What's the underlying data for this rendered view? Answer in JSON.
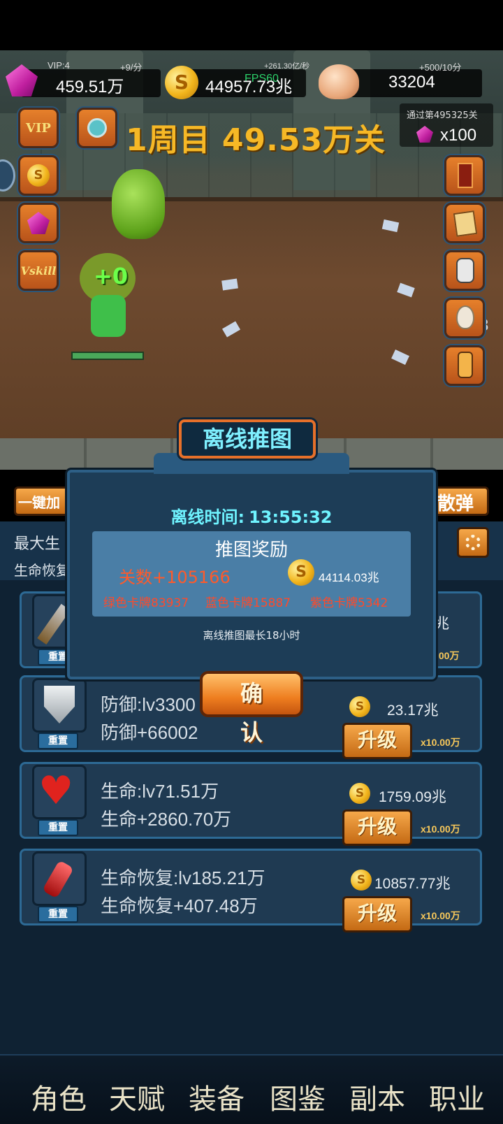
{
  "resources": {
    "gems": {
      "vip": "VIP:4",
      "rate": "+9/分",
      "value": "459.51万"
    },
    "coins": {
      "rate": "+261.30亿/秒",
      "fps": "FPS60",
      "value": "44957.73兆"
    },
    "skulls": {
      "rate": "+500/10分",
      "value": "33204"
    }
  },
  "stage": {
    "title": "1周目 49.53万关"
  },
  "reward_hint": {
    "label": "通过第495325关",
    "gem_count": "x100"
  },
  "left_buttons": {
    "vip": "VIP",
    "skill": "Vskill"
  },
  "floating_text": "+0",
  "side_partial_number": "8",
  "action_bar": {
    "left_label": "一键加",
    "right_label": "散弹"
  },
  "stats_panel": {
    "line1": "最大生",
    "line2": "生命恢复"
  },
  "dialog": {
    "title": "离线推图",
    "offline_time_label": "离线时间:",
    "offline_time_value": "13:55:32",
    "reward_title": "推图奖励",
    "stage_gain": "关数+105166",
    "coin_gain": "44114.03兆",
    "green_cards": "绿色卡牌83937",
    "blue_cards": "蓝色卡牌15887",
    "purple_cards": "紫色卡牌5342",
    "note": "离线推图最长18小时",
    "confirm": "确 认"
  },
  "upgrade_rows": [
    {
      "partial_cost": "兆",
      "partial_mult": ".00万",
      "reset": "重置"
    },
    {
      "name": "防御:lv3300",
      "effect": "防御+66002",
      "cost": "23.17兆",
      "button": "升级",
      "mult": "x10.00万",
      "reset": "重置"
    },
    {
      "name": "生命:lv71.51万",
      "effect": "生命+2860.70万",
      "cost": "1759.09兆",
      "button": "升级",
      "mult": "x10.00万",
      "reset": "重置"
    },
    {
      "name": "生命恢复:lv185.21万",
      "effect": "生命恢复+407.48万",
      "cost": "10857.77兆",
      "button": "升级",
      "mult": "x10.00万",
      "reset": "重置"
    }
  ],
  "bottom_nav": [
    "角色",
    "天赋",
    "装备",
    "图鉴",
    "副本",
    "职业"
  ],
  "colors": {
    "accent_orange": "#e6702a",
    "panel_blue": "#1d3d57",
    "gold": "#f6b826",
    "cyan": "#7ff0ff"
  },
  "icons": [
    "gem-icon",
    "coin-icon",
    "skull-icon",
    "vip-icon",
    "medal-icon",
    "skill-icon",
    "card-icon",
    "robot-icon",
    "egg-icon",
    "lantern-icon",
    "gear-icon",
    "sword-icon",
    "shield-icon",
    "heart-icon",
    "potion-icon"
  ]
}
